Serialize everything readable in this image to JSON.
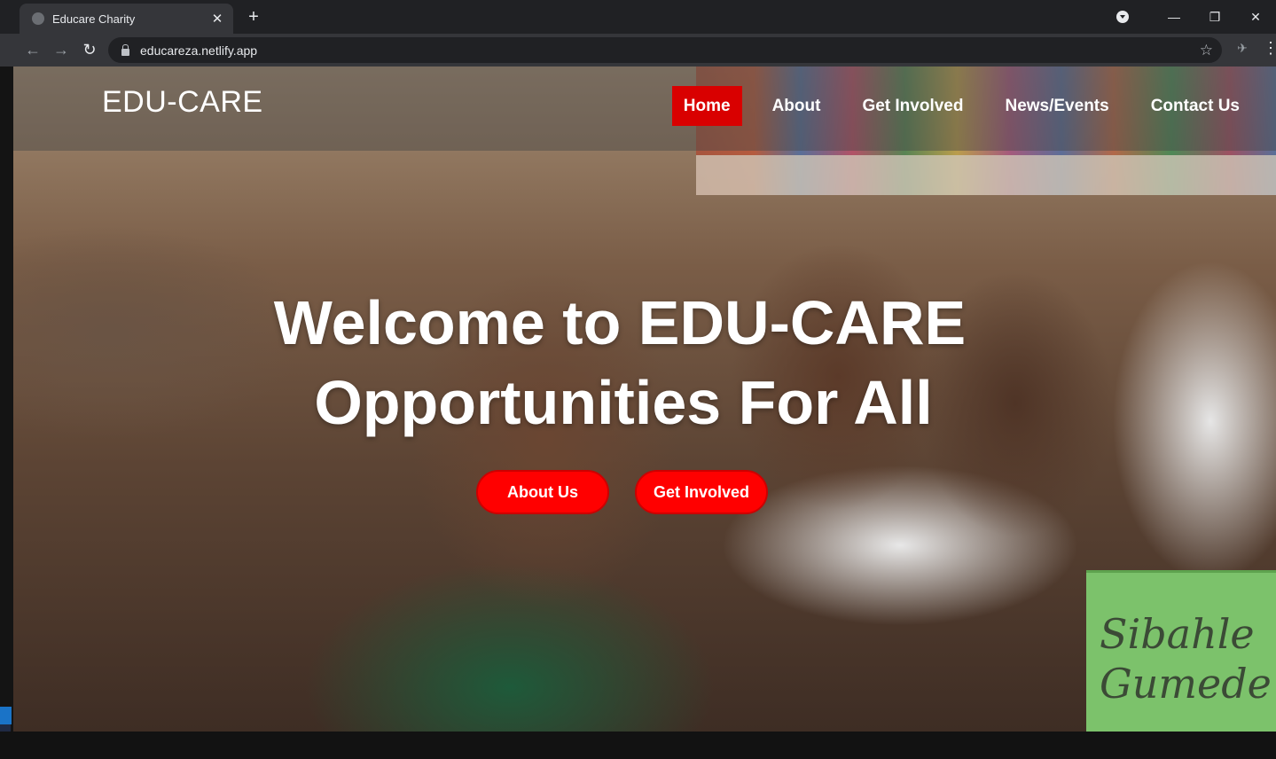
{
  "browser": {
    "tab_title": "Educare Charity",
    "tab_close": "✕",
    "new_tab": "+",
    "url": "educareza.netlify.app",
    "back": "←",
    "forward": "→",
    "reload": "↻",
    "star": "☆",
    "minimize": "—",
    "restore": "❐",
    "close": "✕",
    "menu": "⋮"
  },
  "site": {
    "brand": "EDU-CARE",
    "nav": [
      "Home",
      "About",
      "Get Involved",
      "News/Events",
      "Contact Us"
    ],
    "active_nav": "Home",
    "headline_1": "Welcome to EDU-CARE",
    "headline_2": "Opportunities For All",
    "buttons": [
      "About Us",
      "Get Involved"
    ],
    "card_text_1": "Sibahle",
    "card_text_2": "Gumede"
  },
  "colors": {
    "accent": "#ff0000",
    "nav_active": "#d90000",
    "chrome_dark": "#202124",
    "chrome_toolbar": "#35363a"
  }
}
